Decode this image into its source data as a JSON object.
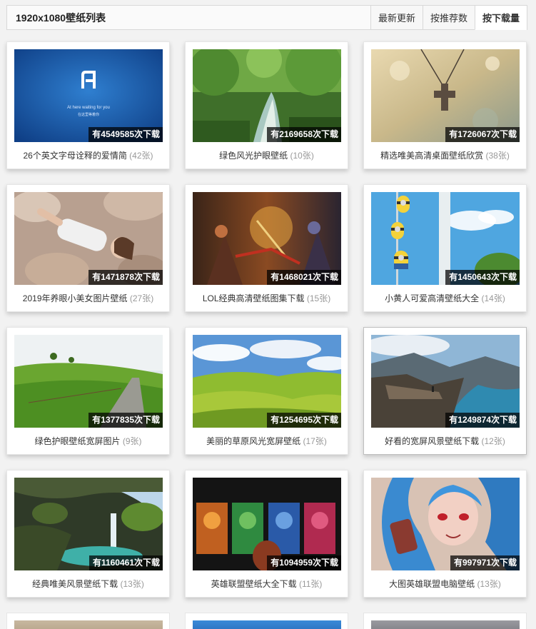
{
  "header": {
    "title": "1920x1080壁纸列表",
    "tabs": [
      {
        "label": "最新更新",
        "active": false
      },
      {
        "label": "按推荐数",
        "active": false
      },
      {
        "label": "按下载量",
        "active": true
      }
    ]
  },
  "cards": [
    {
      "downloads": "有4549585次下载",
      "title": "26个英文字母诠释的爱情简",
      "count": "(42张)",
      "image": "blue-letter-a-wallpaper",
      "thumb_text": {
        "line1": "At here waiting for you",
        "line2": "在这里等着你"
      }
    },
    {
      "downloads": "有2169658次下载",
      "title": "绿色风光护眼壁纸",
      "count": "(10张)",
      "image": "green-forest-stream"
    },
    {
      "downloads": "有1726067次下载",
      "title": "精选唯美高清桌面壁纸欣赏",
      "count": "(38张)",
      "image": "cross-necklace-bokeh"
    },
    {
      "downloads": "有1471878次下载",
      "title": "2019年养眼小美女图片壁纸",
      "count": "(27张)",
      "image": "girl-lying-on-rocks"
    },
    {
      "downloads": "有1468021次下载",
      "title": "LOL经典高清壁纸图集下载",
      "count": "(15张)",
      "image": "lol-battle-artwork"
    },
    {
      "downloads": "有1450643次下载",
      "title": "小黄人可爱高清壁纸大全",
      "count": "(14张)",
      "image": "minions-sky-window"
    },
    {
      "downloads": "有1377835次下载",
      "title": "绿色护眼壁纸宽屏图片",
      "count": "(9张)",
      "image": "green-hill-road"
    },
    {
      "downloads": "有1254695次下载",
      "title": "美丽的草原风光宽屏壁纸",
      "count": "(17张)",
      "image": "green-rolling-hills"
    },
    {
      "downloads": "有1249874次下载",
      "title": "好看的宽屏风景壁纸下载",
      "count": "(12张)",
      "image": "cliff-fjord-landscape"
    },
    {
      "downloads": "有1160461次下载",
      "title": "经典唯美风景壁纸下载",
      "count": "(13张)",
      "image": "waterfall-cave-lagoon"
    },
    {
      "downloads": "有1094959次下载",
      "title": "英雄联盟壁纸大全下载",
      "count": "(11张)",
      "image": "lol-champion-panels"
    },
    {
      "downloads": "有997971次下载",
      "title": "大图英雄联盟电脑壁纸",
      "count": "(13张)",
      "image": "jinx-blue-hair-portrait"
    }
  ],
  "colors": {
    "page_bg": "#f2f2f2",
    "badge_bg": "#000000",
    "count_text": "#999999"
  }
}
